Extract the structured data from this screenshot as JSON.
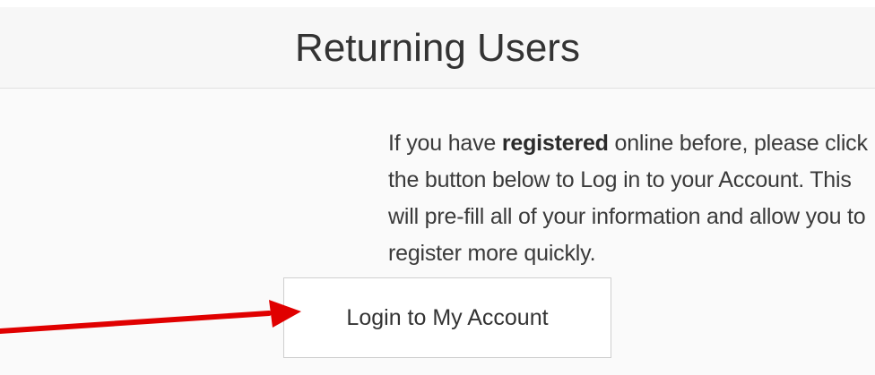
{
  "panel": {
    "title": "Returning Users",
    "intro": {
      "before": "If you have ",
      "emphasis": "registered",
      "after": " online before, please click the button below to Log in to your Account. This will pre-fill all of your information and allow you to register more quickly."
    },
    "login_button_label": "Login to My Account"
  },
  "annotation": {
    "arrow_color": "#e00000"
  }
}
